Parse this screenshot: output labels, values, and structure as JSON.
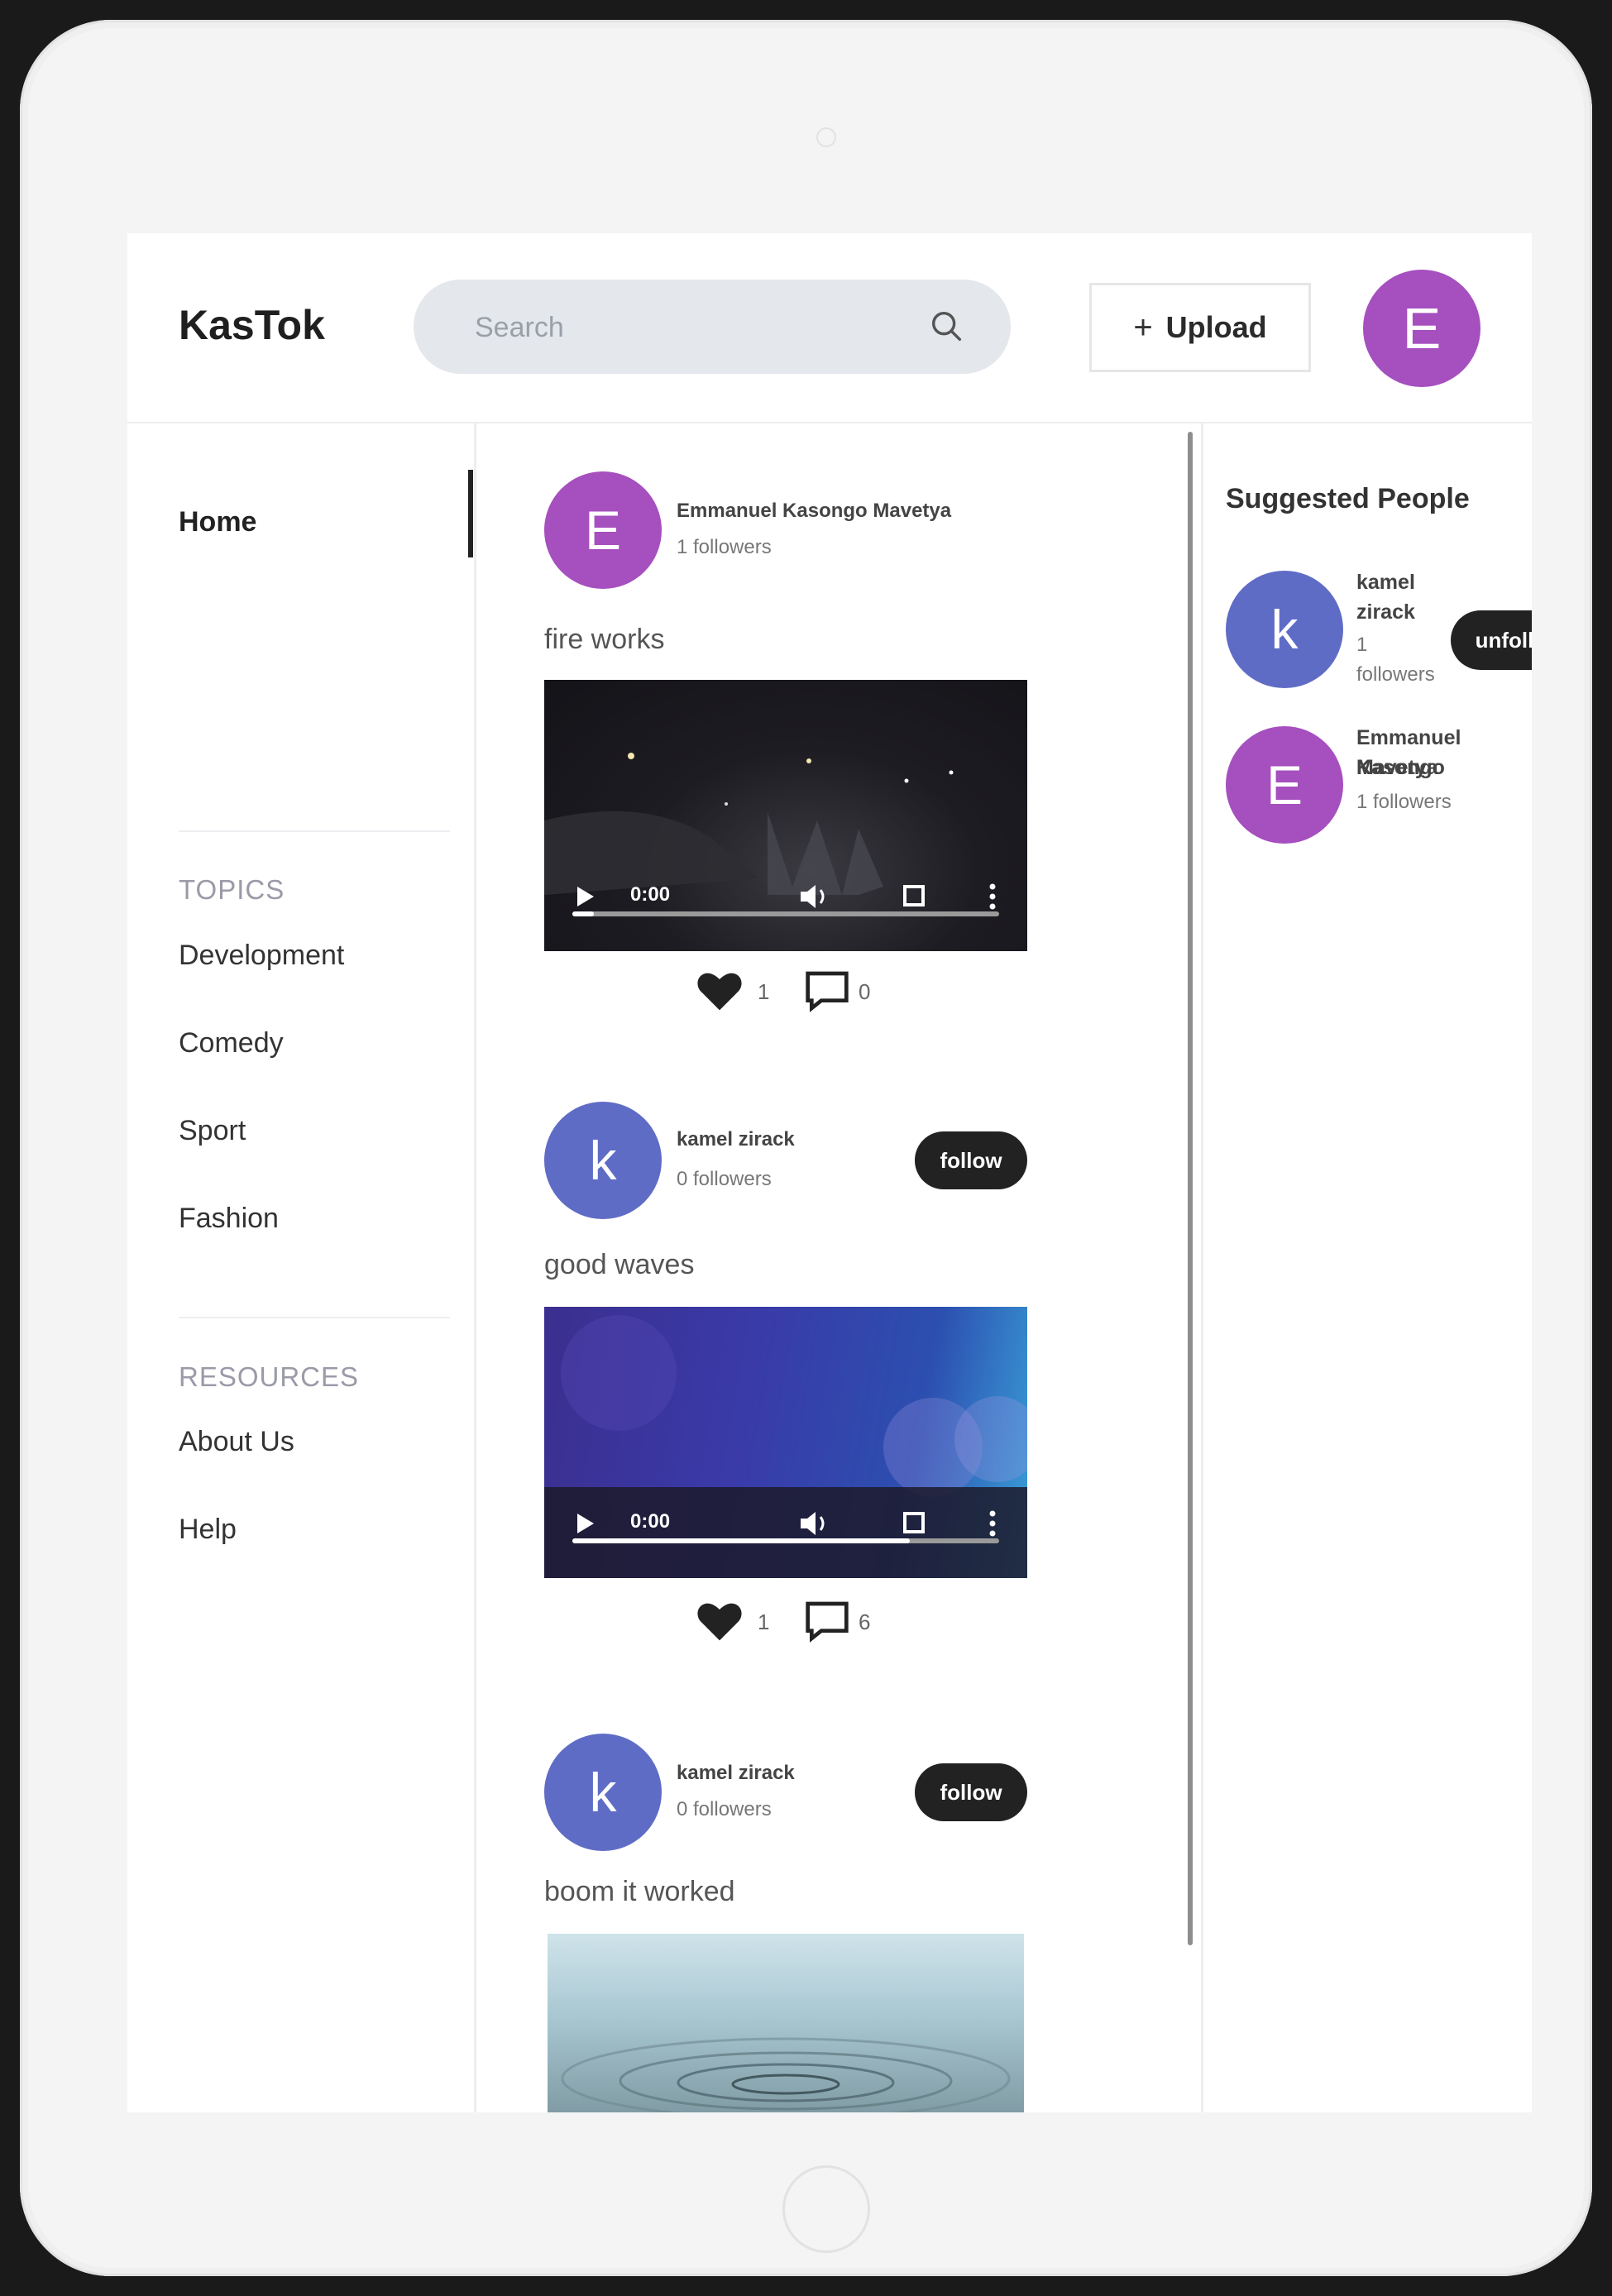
{
  "app": {
    "title": "KasTok"
  },
  "header": {
    "search": {
      "placeholder": "Search"
    },
    "upload_label": "Upload",
    "avatar_letter": "E"
  },
  "sidebar": {
    "home_label": "Home",
    "topics_title": "TOPICS",
    "topics": [
      "Development",
      "Comedy",
      "Sport",
      "Fashion"
    ],
    "resources_title": "RESOURCES",
    "resources": [
      "About Us",
      "Help"
    ]
  },
  "feed": {
    "posts": [
      {
        "avatar_letter": "E",
        "author": "Emmanuel Kasongo Mavetya",
        "followers": "1 followers",
        "caption": "fire works",
        "time": "0:00",
        "progress": 0.05,
        "likes": "1",
        "comments": "0",
        "video_theme": "night-fireworks"
      },
      {
        "avatar_letter": "k",
        "author": "kamel zirack",
        "followers": "0 followers",
        "follow_label": "follow",
        "caption": "good waves",
        "time": "0:00",
        "progress": 0.79,
        "likes": "1",
        "comments": "6",
        "video_theme": "purple-blue-bokeh"
      },
      {
        "avatar_letter": "k",
        "author": "kamel zirack",
        "followers": "0 followers",
        "follow_label": "follow",
        "caption": "boom it worked",
        "video_theme": "water-ripple"
      }
    ]
  },
  "suggested": {
    "title": "Suggested People",
    "people": [
      {
        "avatar_letter": "k",
        "name_line1": "kamel",
        "name_line2": "zirack",
        "followers_line1": "1",
        "followers_line2": "followers",
        "button_label": "unfollow"
      },
      {
        "avatar_letter": "E",
        "name_line1": "Emmanuel Kasongo",
        "name_line2": "Mavetya",
        "followers_line1": "1 followers"
      }
    ]
  },
  "colors": {
    "avatar_purple": "#a64fbf",
    "avatar_blue": "#5f6cc6",
    "dark_button": "#222222",
    "search_bg": "#e4e7ec"
  }
}
